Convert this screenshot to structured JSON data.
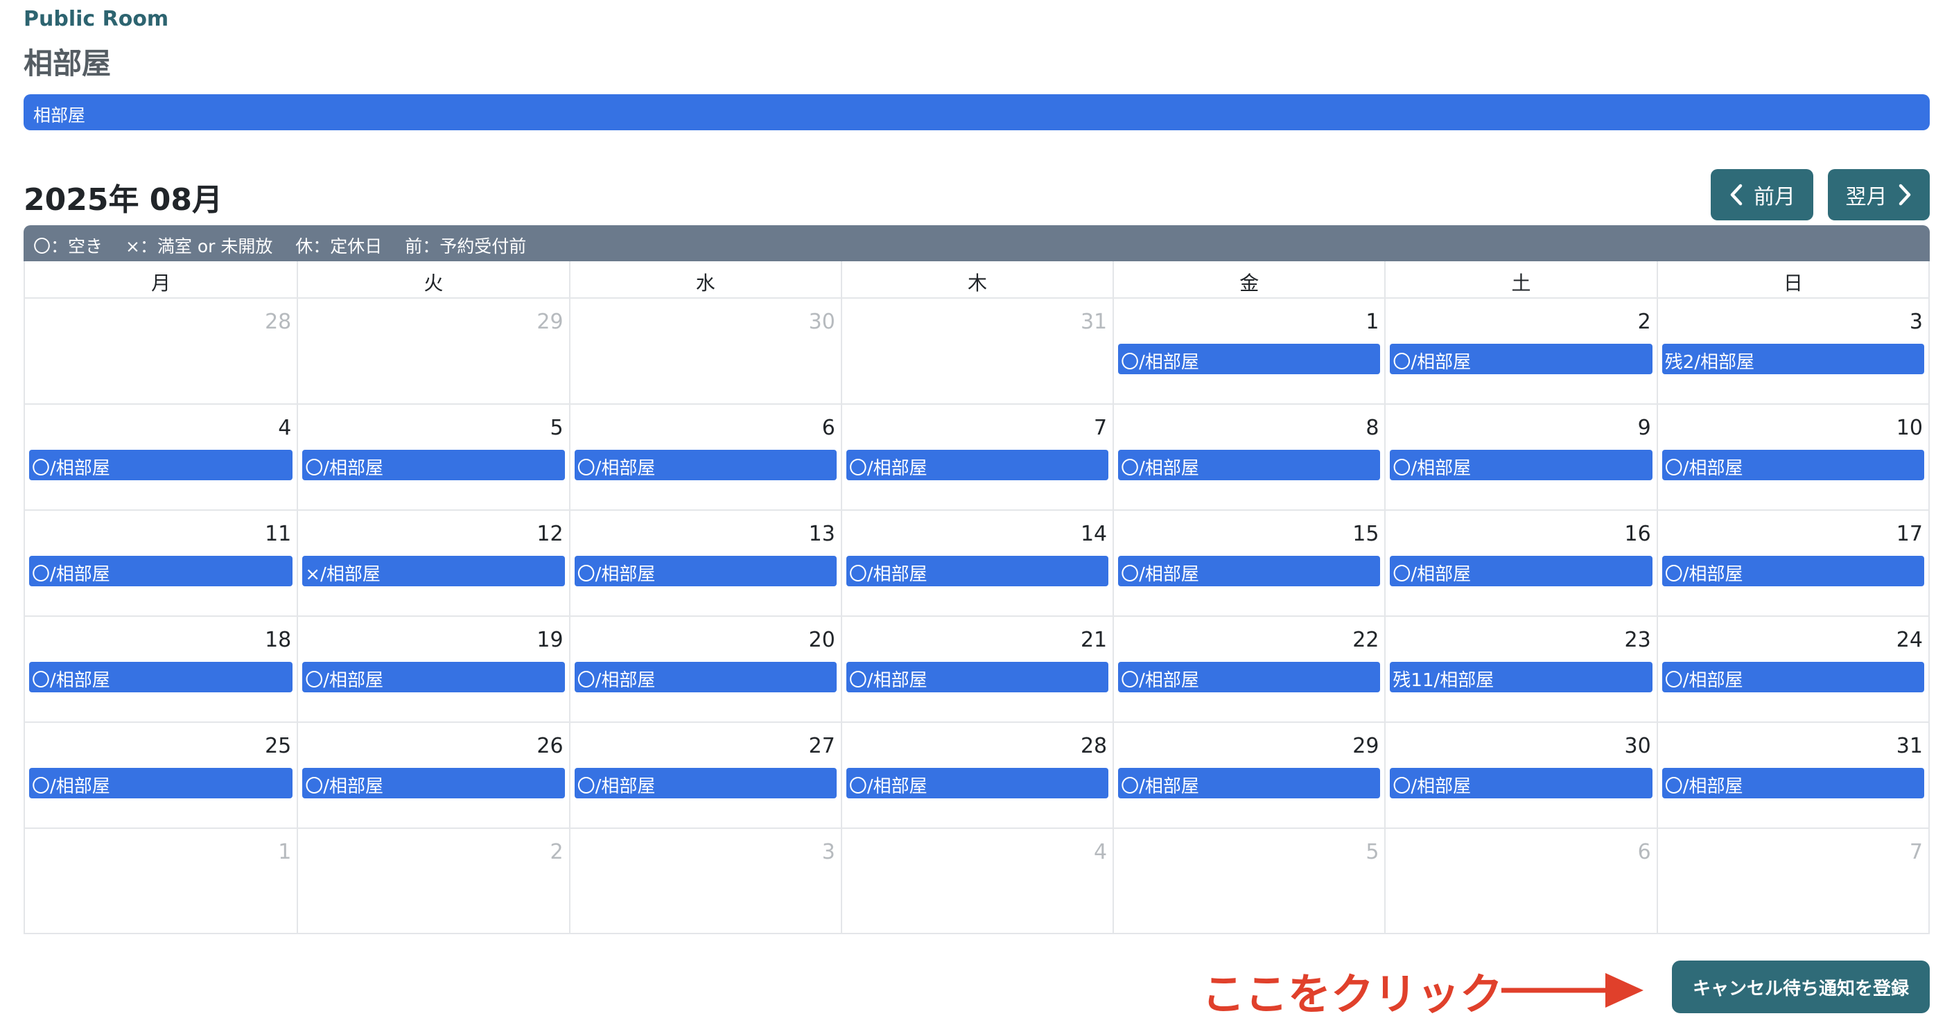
{
  "header": {
    "subtitle": "Public Room",
    "title": "相部屋",
    "room_tab": "相部屋"
  },
  "calendar": {
    "month_title": "2025年 08月",
    "prev_label": "前月",
    "next_label": "翌月",
    "legend": "〇：空き　 ×：満室 or 未開放　 休：定休日　 前：予約受付前",
    "weekdays": [
      "月",
      "火",
      "水",
      "木",
      "金",
      "土",
      "日"
    ],
    "weeks": [
      [
        {
          "day": "28",
          "other": true
        },
        {
          "day": "29",
          "other": true
        },
        {
          "day": "30",
          "other": true
        },
        {
          "day": "31",
          "other": true
        },
        {
          "day": "1",
          "event": "〇/相部屋"
        },
        {
          "day": "2",
          "event": "〇/相部屋"
        },
        {
          "day": "3",
          "event": "残2/相部屋"
        }
      ],
      [
        {
          "day": "4",
          "event": "〇/相部屋"
        },
        {
          "day": "5",
          "event": "〇/相部屋"
        },
        {
          "day": "6",
          "event": "〇/相部屋"
        },
        {
          "day": "7",
          "event": "〇/相部屋"
        },
        {
          "day": "8",
          "event": "〇/相部屋"
        },
        {
          "day": "9",
          "event": "〇/相部屋"
        },
        {
          "day": "10",
          "event": "〇/相部屋"
        }
      ],
      [
        {
          "day": "11",
          "event": "〇/相部屋"
        },
        {
          "day": "12",
          "event": "×/相部屋"
        },
        {
          "day": "13",
          "event": "〇/相部屋"
        },
        {
          "day": "14",
          "event": "〇/相部屋"
        },
        {
          "day": "15",
          "event": "〇/相部屋"
        },
        {
          "day": "16",
          "event": "〇/相部屋"
        },
        {
          "day": "17",
          "event": "〇/相部屋"
        }
      ],
      [
        {
          "day": "18",
          "event": "〇/相部屋"
        },
        {
          "day": "19",
          "event": "〇/相部屋"
        },
        {
          "day": "20",
          "event": "〇/相部屋"
        },
        {
          "day": "21",
          "event": "〇/相部屋"
        },
        {
          "day": "22",
          "event": "〇/相部屋"
        },
        {
          "day": "23",
          "event": "残11/相部屋"
        },
        {
          "day": "24",
          "event": "〇/相部屋"
        }
      ],
      [
        {
          "day": "25",
          "event": "〇/相部屋"
        },
        {
          "day": "26",
          "event": "〇/相部屋"
        },
        {
          "day": "27",
          "event": "〇/相部屋"
        },
        {
          "day": "28",
          "event": "〇/相部屋"
        },
        {
          "day": "29",
          "event": "〇/相部屋"
        },
        {
          "day": "30",
          "event": "〇/相部屋"
        },
        {
          "day": "31",
          "event": "〇/相部屋"
        }
      ],
      [
        {
          "day": "1",
          "other": true
        },
        {
          "day": "2",
          "other": true
        },
        {
          "day": "3",
          "other": true
        },
        {
          "day": "4",
          "other": true
        },
        {
          "day": "5",
          "other": true
        },
        {
          "day": "6",
          "other": true
        },
        {
          "day": "7",
          "other": true
        }
      ]
    ]
  },
  "footer": {
    "annotation": "ここをクリック",
    "waitlist_button": "キャンセル待ち通知を登録"
  },
  "colors": {
    "accent_blue": "#3672e3",
    "teal_button": "#2f6b78",
    "legend_bar": "#6b7a8c",
    "annotation_red": "#e0402b"
  },
  "icons": [
    "chevron-left-icon",
    "chevron-right-icon",
    "arrow-right-icon"
  ]
}
